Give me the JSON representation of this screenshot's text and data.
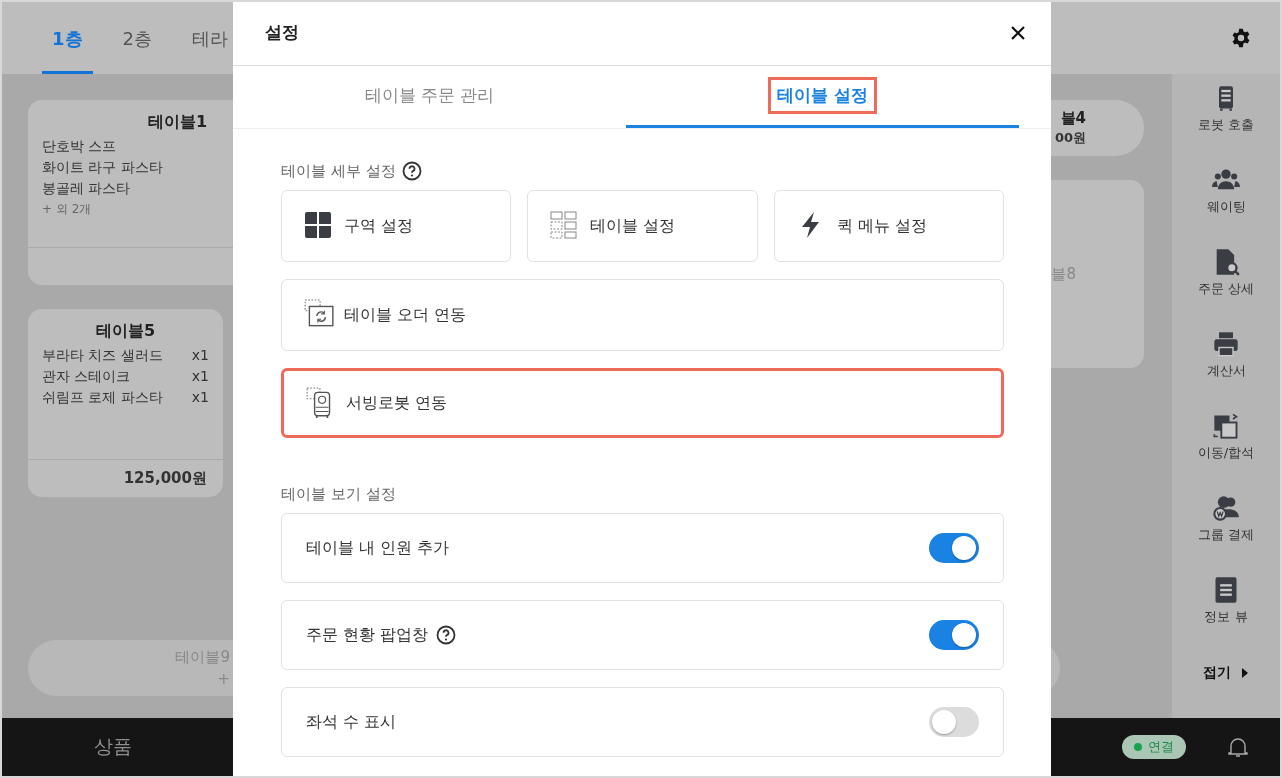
{
  "floor_tabs": [
    {
      "label": "1층",
      "selected": true
    },
    {
      "label": "2층",
      "selected": false
    },
    {
      "label": "테라",
      "selected": false
    }
  ],
  "tables_left": [
    {
      "title": "테이블1",
      "items": [
        {
          "name": "단호박 스프"
        },
        {
          "name": "화이트 라구 파스타"
        },
        {
          "name": "봉골레 파스타"
        }
      ],
      "more": "+ 외 2개"
    },
    {
      "title": "테이블5",
      "items": [
        {
          "name": "부라타 치즈 샐러드",
          "qty": "x1"
        },
        {
          "name": "관자 스테이크",
          "qty": "x1"
        },
        {
          "name": "쉬림프 로제 파스타",
          "qty": "x1"
        }
      ],
      "total": "125,000원"
    }
  ],
  "table_empty_left": {
    "title": "테이블9",
    "add": "+"
  },
  "tables_right": [
    {
      "kind": "compact",
      "title": "블4",
      "amount": "00원"
    },
    {
      "kind": "empty",
      "title": "블8"
    }
  ],
  "sidebar": {
    "items": [
      {
        "label": "로봇 호출"
      },
      {
        "label": "웨이팅"
      },
      {
        "label": "주문 상세"
      },
      {
        "label": "계산서"
      },
      {
        "label": "이동/합석"
      },
      {
        "label": "그룹 결제"
      },
      {
        "label": "정보 뷰"
      }
    ],
    "collapse": "접기"
  },
  "bottom_bar": {
    "product": "상품",
    "connection": "연결",
    "connected": true
  },
  "dialog": {
    "title": "설정",
    "tabs": [
      {
        "label": "테이블 주문 관리",
        "selected": false,
        "highlighted": false
      },
      {
        "label": "테이블 설정",
        "selected": true,
        "highlighted": true
      }
    ],
    "section_detail": "테이블 세부 설정",
    "tiles": [
      {
        "label": "구역 설정"
      },
      {
        "label": "테이블 설정"
      },
      {
        "label": "퀵 메뉴 설정"
      }
    ],
    "links": [
      {
        "label": "테이블 오더 연동",
        "highlighted": false
      },
      {
        "label": "서빙로봇 연동",
        "highlighted": true
      }
    ],
    "section_view": "테이블 보기 설정",
    "toggles": [
      {
        "label": "테이블 내 인원 추가",
        "help": false,
        "on": true
      },
      {
        "label": "주문 현황 팝업창",
        "help": true,
        "on": true
      },
      {
        "label": "좌석 수 표시",
        "help": false,
        "on": false
      }
    ]
  }
}
